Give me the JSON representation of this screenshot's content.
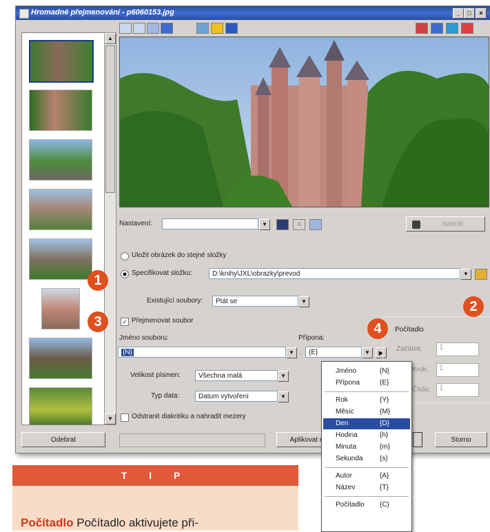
{
  "window": {
    "title": "Hromadné přejmenování - p6060153.jpg",
    "min": "_",
    "max": "□",
    "close": "×"
  },
  "settings": {
    "label": "Nastavení:",
    "value": "",
    "save_label": "Nahrát"
  },
  "output": {
    "radio_same": "Uložit obrázek do stejné složky",
    "radio_specify": "Specifikovat složku:",
    "path": "D:\\knihy\\JXL\\obrazky\\prevod",
    "existing_label": "Existující soubory:",
    "existing_value": "Ptát se"
  },
  "rename": {
    "checkbox": "Přejmenovat soubor",
    "filename_label": "Jméno souboru:",
    "filename_value": "{N}",
    "ext_label": "Přípona:",
    "ext_value": "{E}",
    "dot": ".",
    "size_label": "Velikost písmen:",
    "size_value": "Všechna malá",
    "date_label": "Typ data:",
    "date_value": "Datum vytvoření",
    "diacritics": "Odstranit diakritiku a nahradit mezery"
  },
  "counter": {
    "title": "Počítadlo",
    "start": "Začátek:",
    "step": "Krok:",
    "digits": "Číslic:",
    "start_v": "1",
    "step_v": "1",
    "digits_v": "1"
  },
  "buttons": {
    "remove": "Odebrat",
    "apply": "Aplikovat n",
    "cancel": "Storno"
  },
  "menu": [
    {
      "label": "Jméno",
      "key": "{N}"
    },
    {
      "label": "Přípona",
      "key": "{E}"
    },
    {
      "sep": true
    },
    {
      "label": "Rok",
      "key": "{Y}"
    },
    {
      "label": "Měsíc",
      "key": "{M}"
    },
    {
      "label": "Den",
      "key": "{D}",
      "selected": true
    },
    {
      "label": "Hodina",
      "key": "{h}"
    },
    {
      "label": "Minuta",
      "key": "{m}"
    },
    {
      "label": "Sekunda",
      "key": "{s}"
    },
    {
      "sep": true
    },
    {
      "label": "Autor",
      "key": "{A}"
    },
    {
      "label": "Název",
      "key": "{T}"
    },
    {
      "sep": true
    },
    {
      "label": "Počítadlo",
      "key": "{C}"
    }
  ],
  "badges": [
    "1",
    "2",
    "3",
    "4"
  ],
  "tip": {
    "header": "T I P",
    "bold": "Počítadlo",
    "text": "Počítadlo aktivujete při-"
  },
  "colors": {
    "badge": "#e0501e",
    "tip_header": "#e05a3a",
    "tip_body": "#f9dcc8",
    "titlebar": "#2c4f9e"
  }
}
